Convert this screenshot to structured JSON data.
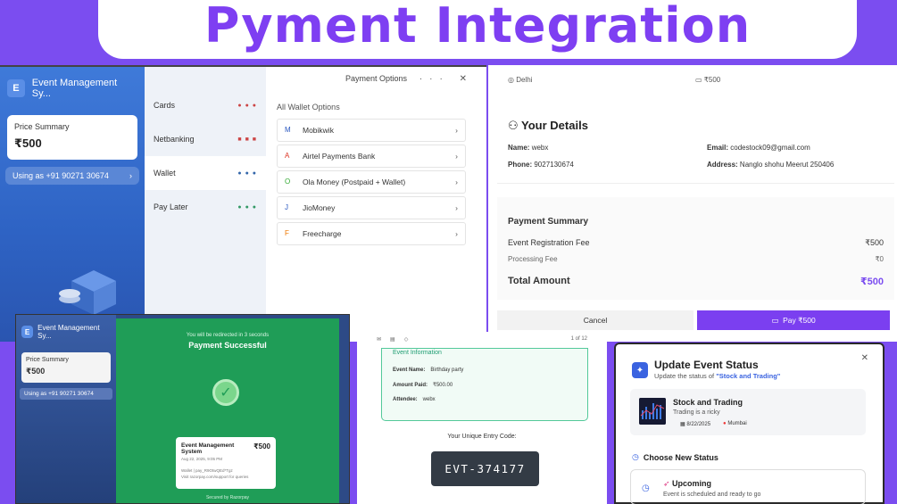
{
  "banner": {
    "title": "Pyment Integration"
  },
  "checkout": {
    "app_initial": "E",
    "app_name": "Event Management Sy...",
    "price_label": "Price Summary",
    "price": "₹500",
    "using_text": "Using as +91 90271 30674",
    "methods": [
      {
        "label": "Cards",
        "selected": false
      },
      {
        "label": "Netbanking",
        "selected": false
      },
      {
        "label": "Wallet",
        "selected": true
      },
      {
        "label": "Pay Later",
        "selected": false
      }
    ],
    "options_title": "Payment Options",
    "window_controls": "··· ✕",
    "wallet_heading": "All Wallet Options",
    "wallets": [
      {
        "name": "Mobikwik",
        "icon": "M"
      },
      {
        "name": "Airtel Payments Bank",
        "icon": "A"
      },
      {
        "name": "Ola Money (Postpaid + Wallet)",
        "icon": "O"
      },
      {
        "name": "JioMoney",
        "icon": "J"
      },
      {
        "name": "Freecharge",
        "icon": "F"
      }
    ]
  },
  "details": {
    "city": "Delhi",
    "price_top": "₹500",
    "heading": "Your Details",
    "name_label": "Name:",
    "name": "webx",
    "phone_label": "Phone:",
    "phone": "9027130674",
    "email_label": "Email:",
    "email": "codestock09@gmail.com",
    "address_label": "Address:",
    "address": "Nanglo shohu Meerut 250406",
    "summary_heading": "Payment Summary",
    "reg_fee_label": "Event Registration Fee",
    "reg_fee": "₹500",
    "proc_fee_label": "Processing Fee",
    "proc_fee": "₹0",
    "total_label": "Total Amount",
    "total": "₹500",
    "cancel_label": "Cancel",
    "pay_label": "Pay ₹500"
  },
  "success": {
    "app_initial": "E",
    "app_name": "Event Management Sy...",
    "price_label": "Price Summary",
    "price": "₹500",
    "using_text": "Using as +91 90271 30674",
    "redirect_text": "You will be redirected in 3 seconds",
    "title": "Payment Successful",
    "merchant": "Event Management System",
    "amount": "₹500",
    "date": "Aug 22, 2025, 9:05 PM",
    "vpa": "Wallet | pay_R9OtwQEd*Tgz",
    "support": "Visit razorpay.com/support for queries",
    "secured": "Secured by Razorpay"
  },
  "entry": {
    "page": "1 of 12",
    "info_title": "Event Information",
    "event_name_label": "Event Name:",
    "event_name": "Birthday party",
    "amount_label": "Amount Paid:",
    "amount": "₹500.00",
    "attendee_label": "Attendee:",
    "attendee": "webx",
    "code_label": "Your Unique Entry Code:",
    "code": "EVT-374177"
  },
  "status": {
    "title": "Update Event Status",
    "subtitle_prefix": "Update the status of ",
    "subtitle_event": "\"Stock and Trading\"",
    "event_name": "Stock and Trading",
    "event_desc": "Trading is a ricky",
    "event_date": "8/22/2025",
    "event_city": "Mumbai",
    "choose_heading": "Choose New Status",
    "option_name": "Upcoming",
    "option_desc": "Event is scheduled and ready to go"
  }
}
